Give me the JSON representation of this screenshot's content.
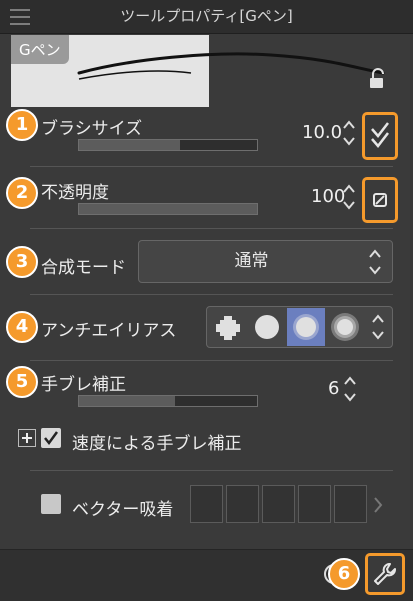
{
  "window": {
    "title": "ツールプロパティ[Gペン]"
  },
  "preview": {
    "label": "Gペン"
  },
  "brush_size": {
    "label": "ブラシサイズ",
    "value": "10.0",
    "slider_fill": 0.57,
    "badge": "1"
  },
  "opacity": {
    "label": "不透明度",
    "value": "100",
    "slider_fill": 1.0,
    "badge": "2"
  },
  "blend_mode": {
    "label": "合成モード",
    "value": "通常",
    "badge": "3"
  },
  "antialiasing": {
    "label": "アンチエイリアス",
    "badge": "4",
    "options": [
      "none",
      "weak",
      "medium",
      "strong"
    ],
    "selected": 2
  },
  "stabilization": {
    "label": "手ブレ補正",
    "value": "6",
    "slider_fill": 0.54,
    "badge": "5"
  },
  "speed_stabilization": {
    "label": "速度による手ブレ補正",
    "checked": true
  },
  "vector_snap": {
    "label": "ベクター吸着",
    "checked": false
  },
  "bottom": {
    "badge": "6"
  },
  "colors": {
    "accent": "#f59a2c",
    "selected_option": "#6b7fbf"
  }
}
